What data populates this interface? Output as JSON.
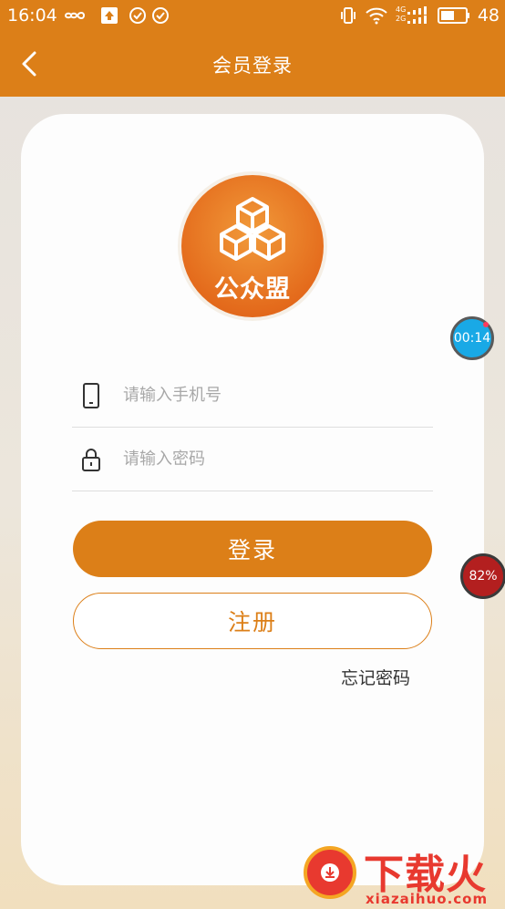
{
  "status_bar": {
    "time": "16:04",
    "network_4g": "4G",
    "network_2g": "2G",
    "battery_level": "48"
  },
  "app_bar": {
    "title": "会员登录",
    "back_icon": "chevron-left-icon"
  },
  "logo": {
    "text": "公众盟",
    "icon": "hexagon-cubes-icon"
  },
  "form": {
    "phone": {
      "placeholder": "请输入手机号",
      "value": "",
      "icon": "phone-icon"
    },
    "password": {
      "placeholder": "请输入密码",
      "value": "",
      "icon": "lock-icon"
    }
  },
  "actions": {
    "login_label": "登录",
    "register_label": "注册",
    "forgot_label": "忘记密码"
  },
  "overlays": {
    "timer_text": "00:14",
    "percent_text": "82%"
  },
  "watermark": {
    "title": "下载火",
    "domain": "xiazaihuo.com"
  },
  "colors": {
    "brand": "#dc7f18",
    "card": "#fdfdfd",
    "placeholder": "#a8a8a8"
  }
}
